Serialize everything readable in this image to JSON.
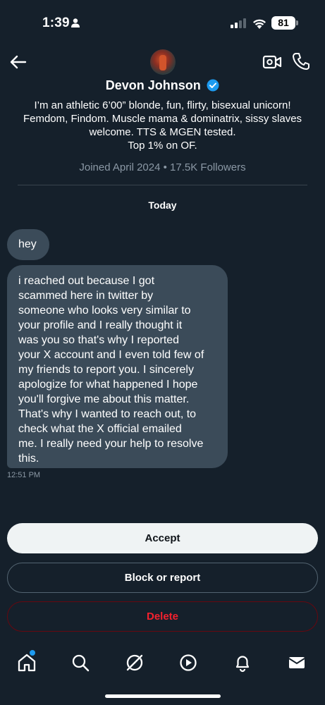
{
  "status_bar": {
    "time": "1:39",
    "battery": "81"
  },
  "header": {
    "display_name": "Devon Johnson",
    "bio_lines": [
      "I’m an athletic 6’00” blonde, fun, flirty, bisexual unicorn!",
      "Femdom, Findom. Muscle mama & dominatrix, sissy slaves",
      "welcome. TTS & MGEN tested.",
      "Top 1% on OF."
    ],
    "meta": "Joined April 2024 • 17.5K Followers"
  },
  "conversation": {
    "date_separator": "Today",
    "messages": [
      {
        "lines": [
          "hey"
        ]
      },
      {
        "lines": [
          "i  reached out because I got",
          "scammed here in twitter by",
          "someone who looks very similar to",
          "your profile and I really thought it",
          "was you so that's why I reported",
          "your X account and I even told few of",
          "my friends to report you. I sincerely",
          "apologize for what happened I hope",
          "you'll forgive me about this matter.",
          "That's why I wanted to reach out, to",
          "check what the X official emailed",
          "me. I really need your help to resolve",
          "this."
        ]
      }
    ],
    "timestamp": "12:51 PM"
  },
  "actions": {
    "accept": "Accept",
    "block_or_report": "Block or report",
    "delete": "Delete"
  },
  "colors": {
    "background": "#15202b",
    "bubble": "#3b4b59",
    "accent": "#1d9bf0",
    "danger": "#f4212e"
  },
  "tab_bar": {
    "icons": [
      "home-icon",
      "search-icon",
      "grok-icon",
      "video-play-icon",
      "notifications-icon",
      "messages-icon"
    ]
  }
}
